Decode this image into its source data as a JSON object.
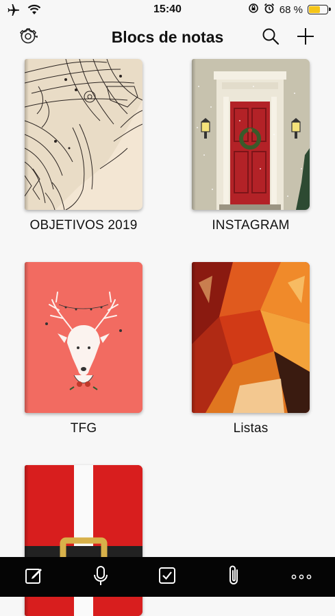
{
  "status": {
    "time": "15:40",
    "battery_text": "68 %",
    "battery_level": 0.68,
    "battery_color": "#f5c518"
  },
  "nav": {
    "title": "Blocs de notas"
  },
  "notebooks": [
    {
      "label": "OBJETIVOS 2019",
      "cover": "elephant-sketch"
    },
    {
      "label": "INSTAGRAM",
      "cover": "christmas-door"
    },
    {
      "label": "TFG",
      "cover": "deer-on-coral"
    },
    {
      "label": "Listas",
      "cover": "abstract-red-orange"
    },
    {
      "label": "",
      "cover": "santa-belt"
    }
  ],
  "toolbar": {
    "icons": [
      "compose-icon",
      "microphone-icon",
      "checkbox-icon",
      "paperclip-icon",
      "more-icon"
    ]
  },
  "colors": {
    "background": "#f7f7f7",
    "toolbar": "#050505",
    "santa_red": "#d81e1e",
    "coral": "#f26d62"
  }
}
